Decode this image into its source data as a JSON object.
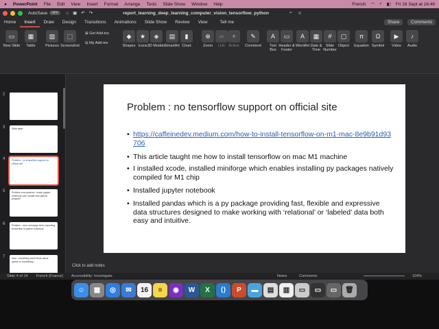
{
  "menubar": {
    "apple": "",
    "app": "PowerPoint",
    "items": [
      "File",
      "Edit",
      "View",
      "Insert",
      "Format",
      "Arrange",
      "Tools",
      "Slide Show",
      "Window",
      "Help"
    ],
    "language": "French",
    "datetime": "Fri 16 Sept at 16:49"
  },
  "titlebar": {
    "autosave": "AutoSave",
    "autosave_state": "OFF",
    "filename": "report_learning_deep_learning_computer_vision_tensorflow_python"
  },
  "tabs": [
    "Home",
    "Insert",
    "Draw",
    "Design",
    "Transitions",
    "Animations",
    "Slide Show",
    "Review",
    "View",
    "Tell me"
  ],
  "share_label": "Share",
  "comments_label": "Comments",
  "ribbon": [
    {
      "label": "New\nSlide",
      "icon": "new-slide-icon"
    },
    {
      "label": "Table",
      "icon": "table-icon"
    },
    {
      "label": "Pictures",
      "icon": "pictures-icon"
    },
    {
      "label": "Screenshot",
      "icon": "screenshot-icon"
    },
    {
      "label": "Get Add-ins",
      "icon": "addins-icon"
    },
    {
      "label": "My Add-ins",
      "icon": "my-addins-icon"
    },
    {
      "label": "Shapes",
      "icon": "shapes-icon"
    },
    {
      "label": "Icons",
      "icon": "icons-icon"
    },
    {
      "label": "3D\nModels",
      "icon": "3d-icon"
    },
    {
      "label": "SmartArt",
      "icon": "smartart-icon"
    },
    {
      "label": "Chart",
      "icon": "chart-icon"
    },
    {
      "label": "Zoom",
      "icon": "zoom-icon"
    },
    {
      "label": "Link",
      "icon": "link-icon"
    },
    {
      "label": "Action",
      "icon": "action-icon"
    },
    {
      "label": "Comment",
      "icon": "comment-icon"
    },
    {
      "label": "Text\nBox",
      "icon": "textbox-icon"
    },
    {
      "label": "Header &\nFooter",
      "icon": "header-icon"
    },
    {
      "label": "WordArt",
      "icon": "wordart-icon"
    },
    {
      "label": "Date &\nTime",
      "icon": "date-icon"
    },
    {
      "label": "Slide\nNumber",
      "icon": "slidenum-icon"
    },
    {
      "label": "Object",
      "icon": "object-icon"
    },
    {
      "label": "Equation",
      "icon": "equation-icon"
    },
    {
      "label": "Symbol",
      "icon": "symbol-icon"
    },
    {
      "label": "Video",
      "icon": "video-icon"
    },
    {
      "label": "Audio",
      "icon": "audio-icon"
    }
  ],
  "thumbnails": [
    {
      "num": "2",
      "title": "",
      "selected": false
    },
    {
      "num": "3",
      "title": "Slide table",
      "selected": false
    },
    {
      "num": "",
      "title": "Why did we install tensorflow ?",
      "selected": false
    },
    {
      "num": "4",
      "title": "Problem : no tensorflow support on official site",
      "selected": true
    },
    {
      "num": "5",
      "title": "Problem encountered : made jupyter notebook can't create new python program",
      "selected": false
    },
    {
      "num": "6",
      "title": "Problem : error message when importing tensorflow in python notebook",
      "selected": false
    },
    {
      "num": "7",
      "title": "Now : something didn't think about python is something I",
      "selected": false
    }
  ],
  "slide": {
    "title": "Problem : no tensorflow support on official site",
    "bullets": [
      {
        "text": "https://caffeinedev.medium.com/how-to-install-tensorflow-on-m1-mac-8e9b91d93706",
        "link": true
      },
      {
        "text": "This article taught me how to install tensorflow on mac M1 machine",
        "link": false
      },
      {
        "text": "I installed xcode, installed miniforge which enables installing py packages natively compiled for M1 chip",
        "link": false
      },
      {
        "text": "Installed jupyter notebook",
        "link": false
      },
      {
        "text": "Installed  pandas which is a py package providing fast, flexible and expressive data structures designed to make working with ‘relational’ or ‘labeled’ data both easy and intuitive.",
        "link": false
      }
    ]
  },
  "notes_placeholder": "Click to add notes",
  "status": {
    "slide": "Slide 4 of 14",
    "language": "French (France)",
    "accessibility": "Accessibility: Investigate",
    "notes": "Notes",
    "comments": "Comments",
    "zoom": "104%"
  },
  "dock": [
    {
      "name": "finder",
      "color": "#3b8ee8",
      "glyph": "☺"
    },
    {
      "name": "launchpad",
      "color": "#888",
      "glyph": "▦"
    },
    {
      "name": "safari",
      "color": "#2f7de1",
      "glyph": "◎"
    },
    {
      "name": "mail",
      "color": "#3a7bd5",
      "glyph": "✉"
    },
    {
      "name": "calendar",
      "color": "#f2f2f2",
      "glyph": "16"
    },
    {
      "name": "notes",
      "color": "#f6d64a",
      "glyph": "≡"
    },
    {
      "name": "github",
      "color": "#7a2fbf",
      "glyph": "◉"
    },
    {
      "name": "word",
      "color": "#2b5797",
      "glyph": "W"
    },
    {
      "name": "excel",
      "color": "#217346",
      "glyph": "X"
    },
    {
      "name": "vscode",
      "color": "#2a7bd1",
      "glyph": "⟨⟩"
    },
    {
      "name": "powerpoint",
      "color": "#c94d2b",
      "glyph": "P"
    },
    {
      "name": "folder",
      "color": "#4aa3df",
      "glyph": "▬"
    },
    {
      "name": "preview",
      "color": "#ddd",
      "glyph": "▤"
    },
    {
      "name": "doc",
      "color": "#eee",
      "glyph": "▥"
    },
    {
      "name": "window1",
      "color": "#ccc",
      "glyph": "▭"
    },
    {
      "name": "window2",
      "color": "#333",
      "glyph": "▭"
    },
    {
      "name": "window3",
      "color": "#666",
      "glyph": "▭"
    },
    {
      "name": "trash",
      "color": "#aaa",
      "glyph": "🗑"
    }
  ]
}
